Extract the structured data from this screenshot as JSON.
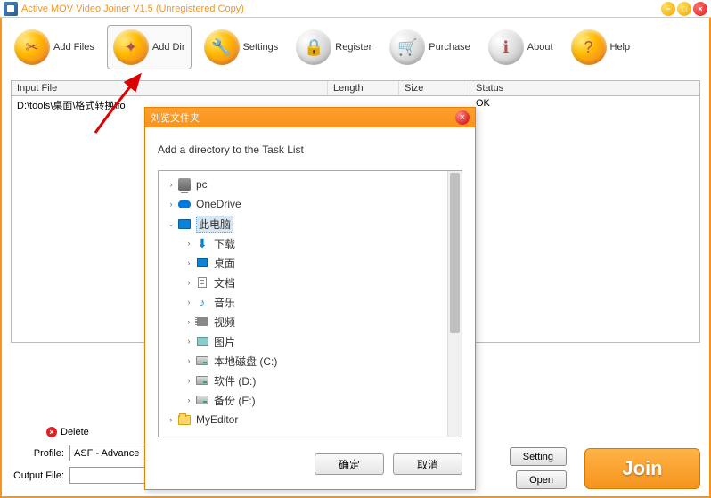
{
  "titlebar": {
    "title": "Active MOV Video Joiner V1.5 (Unregistered Copy)"
  },
  "toolbar": {
    "addFiles": "Add Files",
    "addDir": "Add Dir",
    "settings": "Settings",
    "register": "Register",
    "purchase": "Purchase",
    "about": "About",
    "help": "Help"
  },
  "table": {
    "headers": {
      "inputFile": "Input File",
      "length": "Length",
      "size": "Size",
      "status": "Status"
    },
    "rows": [
      {
        "inputFile": "D:\\tools\\桌面\\格式转换\\fo",
        "length": "",
        "size": "",
        "status": "OK"
      }
    ]
  },
  "controls": {
    "delete": "Delete",
    "profileLabel": "Profile:",
    "profileValue": "ASF - Advance",
    "outputLabel": "Output File:",
    "outputValue": "",
    "setting": "Setting",
    "open": "Open",
    "join": "Join"
  },
  "dialog": {
    "title": "刘览文件夹",
    "prompt": "Add a directory to the Task List",
    "ok": "确定",
    "cancel": "取消",
    "tree": [
      {
        "level": 0,
        "expander": ">",
        "icon": "pc",
        "label": "pc",
        "selected": false
      },
      {
        "level": 0,
        "expander": ">",
        "icon": "od",
        "label": "OneDrive",
        "selected": false
      },
      {
        "level": 0,
        "expander": "v",
        "icon": "mon",
        "label": "此电脑",
        "selected": true
      },
      {
        "level": 1,
        "expander": ">",
        "icon": "dl",
        "label": "下载",
        "selected": false
      },
      {
        "level": 1,
        "expander": ">",
        "icon": "desk",
        "label": "桌面",
        "selected": false
      },
      {
        "level": 1,
        "expander": ">",
        "icon": "doc",
        "label": "文档",
        "selected": false
      },
      {
        "level": 1,
        "expander": ">",
        "icon": "music",
        "label": "音乐",
        "selected": false
      },
      {
        "level": 1,
        "expander": ">",
        "icon": "video",
        "label": "视频",
        "selected": false
      },
      {
        "level": 1,
        "expander": ">",
        "icon": "pic",
        "label": "图片",
        "selected": false
      },
      {
        "level": 1,
        "expander": ">",
        "icon": "disk",
        "label": "本地磁盘 (C:)",
        "selected": false
      },
      {
        "level": 1,
        "expander": ">",
        "icon": "disk",
        "label": "软件 (D:)",
        "selected": false
      },
      {
        "level": 1,
        "expander": ">",
        "icon": "disk",
        "label": "备份 (E:)",
        "selected": false
      },
      {
        "level": 0,
        "expander": ">",
        "icon": "folder",
        "label": "MyEditor",
        "selected": false
      }
    ]
  }
}
